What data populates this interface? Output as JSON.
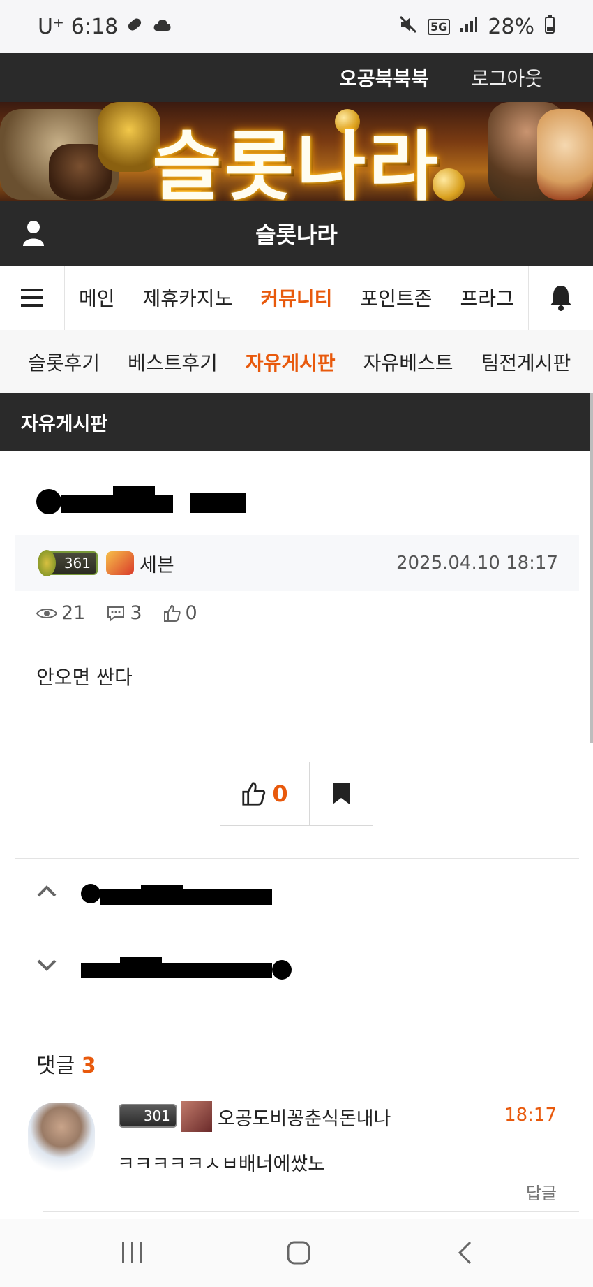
{
  "status_bar": {
    "carrier": "U⁺",
    "time": "6:18",
    "network": "5G",
    "battery": "28%"
  },
  "top_bar": {
    "nickname": "오공북북북",
    "logout": "로그아웃"
  },
  "banner": {
    "title": "슬롯나라"
  },
  "site_bar": {
    "title": "슬롯나라"
  },
  "main_nav": {
    "items": [
      {
        "label": "메인"
      },
      {
        "label": "제휴카지노"
      },
      {
        "label": "커뮤니티"
      },
      {
        "label": "포인트존"
      },
      {
        "label": "프라그"
      }
    ],
    "active_index": 2
  },
  "sub_nav": {
    "items": [
      {
        "label": "슬롯후기"
      },
      {
        "label": "베스트후기"
      },
      {
        "label": "자유게시판"
      },
      {
        "label": "자유베스트"
      },
      {
        "label": "팀전게시판"
      }
    ],
    "active_index": 2
  },
  "board": {
    "name": "자유게시판"
  },
  "post": {
    "author": {
      "level": "361",
      "name": "세븐"
    },
    "date": "2025.04.10 18:17",
    "views": "21",
    "comments": "3",
    "likes": "0",
    "body": "안오면 싼다",
    "like_button_count": "0"
  },
  "comments": {
    "label": "댓글",
    "count": "3",
    "items": [
      {
        "level": "301",
        "author": "오공도비꽁춘식돈내나",
        "time": "18:17",
        "text": "ㅋㅋㅋㅋㅋㅅㅂ배너에쌌노",
        "reply": "답글"
      }
    ]
  },
  "colors": {
    "accent": "#e8590c",
    "dark_bar": "#2a2a2a"
  }
}
